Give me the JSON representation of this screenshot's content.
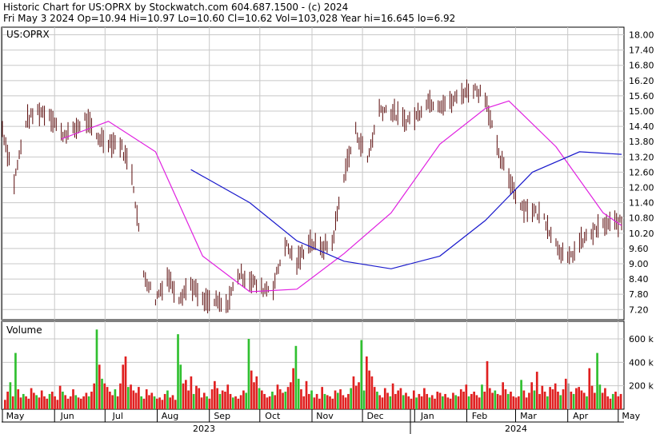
{
  "header": {
    "line1": "Historic Chart for US:OPRX by Stockwatch.com 604.687.1500 - (c) 2024",
    "line2": "Fri May  3 2024  Op=10.94  Hi=10.97  Lo=10.60  Cl=10.62  Vol=103,028  Year hi=16.645  lo=6.92"
  },
  "colors": {
    "background": "#ffffff",
    "grid": "#c8c8c8",
    "price_bar": "#5a0a0a",
    "ma_short": "#e020e0",
    "ma_long": "#1a1acc",
    "volume_up": "#30c030",
    "volume_down": "#e02020",
    "volume_neutral": "#a0a0a0",
    "frame": "#000000"
  },
  "chart_data": [
    {
      "type": "line",
      "title": "US:OPRX",
      "xlabel": "",
      "ylabel": "",
      "ylim": [
        6.8,
        18.3
      ],
      "y_ticks": [
        "18.00",
        "17.40",
        "16.80",
        "16.20",
        "15.60",
        "15.00",
        "14.40",
        "13.80",
        "13.20",
        "12.60",
        "12.00",
        "11.40",
        "10.80",
        "10.20",
        "9.60",
        "9.00",
        "8.40",
        "7.80",
        "7.20"
      ],
      "x_tick_labels": [
        "May",
        "Jun",
        "Jul",
        "Aug",
        "Sep",
        "Oct",
        "Nov",
        "Dec",
        "Jan",
        "Feb",
        "Mar",
        "Apr",
        "May"
      ],
      "year_labels": [
        "2023",
        "2024"
      ],
      "grid": true,
      "series": [
        {
          "type": "ohlc",
          "x": [
            "2023-05-01",
            "2023-05-08",
            "2023-05-15",
            "2023-05-22",
            "2023-05-29",
            "2023-06-05",
            "2023-06-12",
            "2023-06-19",
            "2023-06-26",
            "2023-07-03",
            "2023-07-10",
            "2023-07-17",
            "2023-07-24",
            "2023-07-31",
            "2023-08-07",
            "2023-08-14",
            "2023-08-21",
            "2023-08-28",
            "2023-09-04",
            "2023-09-11",
            "2023-09-18",
            "2023-09-25",
            "2023-10-02",
            "2023-10-09",
            "2023-10-16",
            "2023-10-23",
            "2023-10-30",
            "2023-11-06",
            "2023-11-13",
            "2023-11-20",
            "2023-11-27",
            "2023-12-04",
            "2023-12-11",
            "2023-12-18",
            "2023-12-26",
            "2024-01-02",
            "2024-01-08",
            "2024-01-16",
            "2024-01-22",
            "2024-01-29",
            "2024-02-05",
            "2024-02-12",
            "2024-02-20",
            "2024-02-26",
            "2024-03-04",
            "2024-03-11",
            "2024-03-18",
            "2024-03-25",
            "2024-04-01",
            "2024-04-08",
            "2024-04-15",
            "2024-04-22",
            "2024-04-29"
          ],
          "values": [
            14.3,
            12.2,
            14.6,
            15.0,
            14.9,
            14.1,
            14.2,
            14.7,
            14.0,
            13.8,
            13.7,
            12.6,
            8.6,
            7.6,
            8.5,
            7.7,
            8.2,
            7.5,
            7.5,
            7.3,
            8.6,
            8.4,
            8.0,
            8.1,
            9.8,
            9.0,
            9.9,
            9.6,
            9.8,
            12.5,
            14.2,
            13.1,
            15.1,
            15.0,
            14.6,
            14.8,
            15.4,
            15.3,
            15.3,
            15.7,
            15.9,
            15.6,
            13.2,
            12.4,
            11.3,
            11.1,
            10.8,
            9.8,
            9.1,
            9.8,
            10.2,
            10.5,
            10.6
          ],
          "note": "weekly closes"
        },
        {
          "name": "",
          "type": "line",
          "x": [
            "2023-06-05",
            "2023-07-03",
            "2023-07-31",
            "2023-08-28",
            "2023-09-25",
            "2023-10-23",
            "2023-11-20",
            "2023-12-18",
            "2024-01-16",
            "2024-02-12",
            "2024-02-26",
            "2024-03-25",
            "2024-04-22",
            "2024-05-03"
          ],
          "values": [
            13.9,
            14.6,
            13.4,
            9.3,
            7.9,
            8.0,
            9.4,
            11.0,
            13.7,
            15.1,
            15.4,
            13.6,
            11.0,
            10.5
          ]
        },
        {
          "name": "",
          "type": "line",
          "x": [
            "2023-08-21",
            "2023-09-25",
            "2023-10-23",
            "2023-11-20",
            "2023-12-18",
            "2024-01-16",
            "2024-02-12",
            "2024-03-11",
            "2024-04-08",
            "2024-05-03"
          ],
          "values": [
            12.7,
            11.4,
            9.9,
            9.1,
            8.8,
            9.3,
            10.7,
            12.6,
            13.4,
            13.3
          ]
        }
      ]
    },
    {
      "type": "bar",
      "title": "Volume",
      "xlabel": "",
      "ylabel": "",
      "ylim": [
        0,
        750000
      ],
      "y_ticks": [
        "600 k",
        "400 k",
        "200 k"
      ],
      "values": [
        80000,
        150000,
        230000,
        110000,
        480000,
        170000,
        100000,
        130000,
        110000,
        90000,
        180000,
        140000,
        120000,
        100000,
        160000,
        110000,
        90000,
        130000,
        150000,
        110000,
        80000,
        200000,
        150000,
        120000,
        90000,
        110000,
        170000,
        120000,
        100000,
        90000,
        110000,
        140000,
        110000,
        150000,
        220000,
        680000,
        380000,
        260000,
        220000,
        190000,
        150000,
        120000,
        170000,
        110000,
        220000,
        380000,
        450000,
        190000,
        210000,
        160000,
        140000,
        190000,
        110000,
        90000,
        170000,
        120000,
        140000,
        110000,
        90000,
        100000,
        80000,
        130000,
        160000,
        100000,
        120000,
        80000,
        640000,
        380000,
        220000,
        250000,
        160000,
        280000,
        130000,
        200000,
        180000,
        100000,
        140000,
        110000,
        90000,
        170000,
        240000,
        180000,
        130000,
        160000,
        150000,
        210000,
        130000,
        100000,
        110000,
        90000,
        120000,
        160000,
        140000,
        600000,
        330000,
        230000,
        280000,
        180000,
        160000,
        130000,
        100000,
        110000,
        150000,
        120000,
        210000,
        170000,
        140000,
        150000,
        190000,
        230000,
        350000,
        540000,
        260000,
        170000,
        110000,
        240000,
        130000,
        160000,
        100000,
        130000,
        90000,
        190000,
        130000,
        120000,
        110000,
        90000,
        160000,
        140000,
        170000,
        120000,
        100000,
        130000,
        180000,
        280000,
        200000,
        230000,
        590000,
        160000,
        450000,
        330000,
        280000,
        190000,
        150000,
        120000,
        100000,
        180000,
        140000,
        110000,
        220000,
        130000,
        160000,
        180000,
        120000,
        140000,
        110000,
        90000,
        160000,
        100000,
        130000,
        110000,
        180000,
        130000,
        100000,
        120000,
        90000,
        150000,
        140000,
        110000,
        130000,
        100000,
        90000,
        140000,
        120000,
        110000,
        170000,
        150000,
        210000,
        110000,
        130000,
        150000,
        120000,
        100000,
        210000,
        150000,
        410000,
        180000,
        140000,
        160000,
        130000,
        120000,
        230000,
        170000,
        130000,
        150000,
        110000,
        100000,
        110000,
        250000,
        160000,
        100000,
        140000,
        230000,
        160000,
        320000,
        130000,
        200000,
        150000,
        110000,
        190000,
        170000,
        220000,
        150000,
        120000,
        170000,
        260000,
        220000,
        150000,
        130000,
        180000,
        190000,
        160000,
        140000,
        110000,
        350000,
        200000,
        140000,
        480000,
        210000,
        140000,
        180000,
        110000,
        90000,
        130000,
        150000,
        110000,
        130000
      ]
    }
  ]
}
